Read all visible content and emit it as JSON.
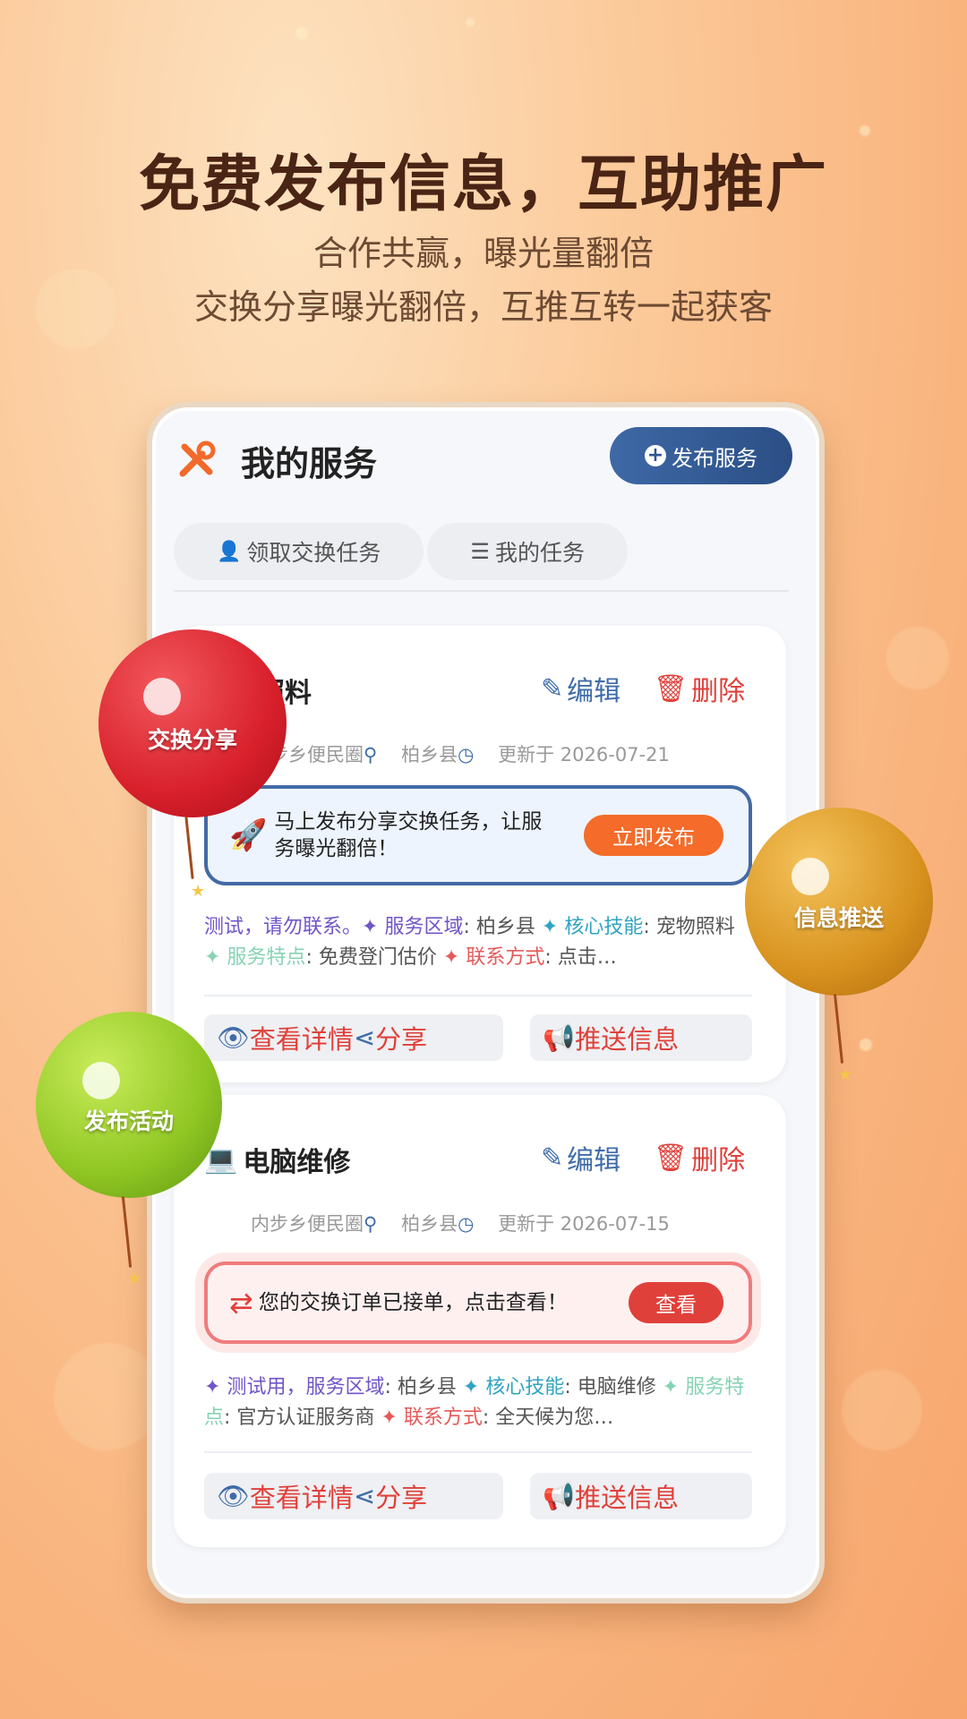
{
  "hero": {
    "title": "免费发布信息，互助推广",
    "subtitle1": "合作共赢，曝光量翻倍",
    "subtitle2": "交换分享曝光翻倍，互推互转一起获客"
  },
  "app": {
    "title": "我的服务",
    "publish_button": "发布服务",
    "tabs": [
      "领取交换任务",
      "我的任务"
    ]
  },
  "cards": [
    {
      "title": "宠物照料",
      "edit_label": "编辑",
      "delete_label": "删除",
      "circle": "内步乡便民圈",
      "region": "柏乡县",
      "updated": "更新于 2026-07-21",
      "banner_text_1": "马上发布分享交换任务，让服",
      "banner_text_2": "务曝光翻倍！",
      "banner_button": "立即发布",
      "desc": {
        "prefix": "测试，请勿联系。",
        "area_label": "服务区域",
        "area_value": "柏乡县",
        "skill_label": "核心技能",
        "skill_value": "宠物照料",
        "feature_label": "服务特点",
        "feature_value": "免费登门估价",
        "contact_label": "联系方式",
        "contact_value": "点击…"
      },
      "view_label": "查看详情",
      "share_label": "分享",
      "push_label": "推送信息"
    },
    {
      "title": "电脑维修",
      "edit_label": "编辑",
      "delete_label": "删除",
      "circle": "内步乡便民圈",
      "region": "柏乡县",
      "updated": "更新于 2026-07-15",
      "banner_text_1": "您的交换订单已接单，点击查看！",
      "banner_button": "查看",
      "desc": {
        "prefix": "测试用，",
        "area_label": "服务区域",
        "area_value": "柏乡县",
        "skill_label": "核心技能",
        "skill_value": "电脑维修",
        "feature_label": "服务特点",
        "feature_value": "官方认证服务商",
        "contact_label": "联系方式",
        "contact_value": "全天候为您…"
      },
      "view_label": "查看详情",
      "share_label": "分享",
      "push_label": "推送信息"
    }
  ],
  "balloons": {
    "red": "交换分享",
    "gold": "信息推送",
    "green": "发布活动"
  },
  "colors": {
    "brand_blue": "#3e69a6",
    "accent_orange": "#f46b2a",
    "danger_red": "#e0403a"
  }
}
